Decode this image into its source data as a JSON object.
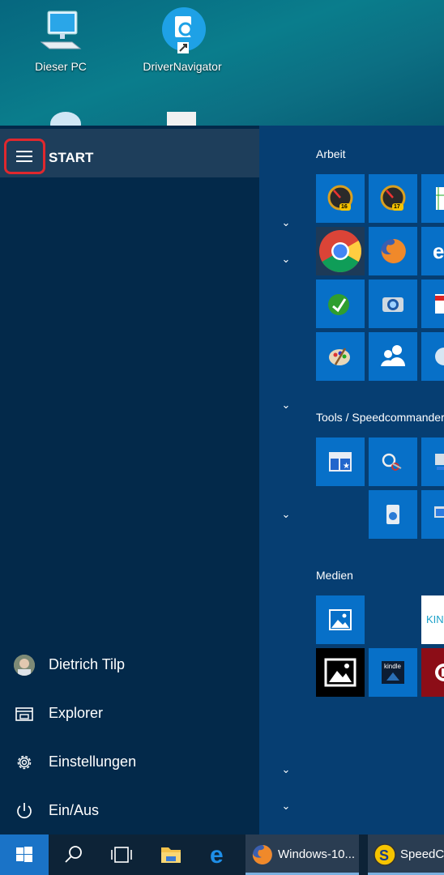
{
  "desktop": {
    "icons": [
      {
        "label": "Dieser PC",
        "icon": "computer-icon"
      },
      {
        "label": "DriverNavigator",
        "icon": "driver-navigator-icon"
      }
    ]
  },
  "start": {
    "title": "START",
    "menu_icon": "hamburger-menu-icon",
    "left_items": [
      {
        "label": "Dietrich Tilp",
        "icon": "user-avatar-icon"
      },
      {
        "label": "Explorer",
        "icon": "file-explorer-icon"
      },
      {
        "label": "Einstellungen",
        "icon": "gear-icon"
      },
      {
        "label": "Ein/Aus",
        "icon": "power-icon"
      }
    ],
    "groups": [
      {
        "title": "Arbeit"
      },
      {
        "title": "Tools / Speedcommander"
      },
      {
        "title": "Medien"
      }
    ],
    "tiles": {
      "arbeit": [
        "16",
        "17"
      ],
      "medien_kindle": "kindle",
      "medien_partial": "KIN"
    }
  },
  "taskbar": {
    "apps": [
      {
        "label": "Windows-10...",
        "icon": "firefox-icon"
      },
      {
        "label": "SpeedCo",
        "icon": "speedcommander-icon"
      }
    ]
  },
  "colors": {
    "start_left_bg": "#03294a",
    "start_right_bg": "#063e72",
    "tile_blue": "#0770c8",
    "highlight_red": "#e0282e",
    "taskbar_bg": "#0d2337"
  }
}
